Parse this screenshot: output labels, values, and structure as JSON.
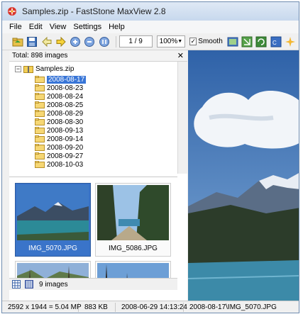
{
  "window": {
    "title": "Samples.zip - FastStone MaxView 2.8"
  },
  "menu": [
    "File",
    "Edit",
    "View",
    "Settings",
    "Help"
  ],
  "toolbar": {
    "page_counter": "1 / 9",
    "zoom": "100%",
    "smooth_label": "Smooth",
    "smooth_checked": true
  },
  "tree": {
    "header": "Total: 898 images",
    "root": "Samples.zip",
    "items": [
      "2008-08-17",
      "2008-08-23",
      "2008-08-24",
      "2008-08-25",
      "2008-08-29",
      "2008-08-30",
      "2008-09-13",
      "2008-09-14",
      "2008-09-20",
      "2008-09-27",
      "2008-10-03"
    ],
    "selected_index": 0
  },
  "thumbnails": [
    {
      "label": "IMG_5070.JPG",
      "selected": true
    },
    {
      "label": "IMG_5086.JPG",
      "selected": false
    },
    {
      "label": "",
      "selected": false
    },
    {
      "label": "",
      "selected": false
    }
  ],
  "thumb_status": "9 images",
  "status": {
    "dimensions": "2592 x 1944 = 5.04 MP",
    "size": "883 KB",
    "datetime": "2008-06-29 14:13:24",
    "path": "2008-08-17\\IMG_5070.JPG"
  },
  "colors": {
    "selection": "#3875d7",
    "thumb_selected": "#3a74c9"
  }
}
